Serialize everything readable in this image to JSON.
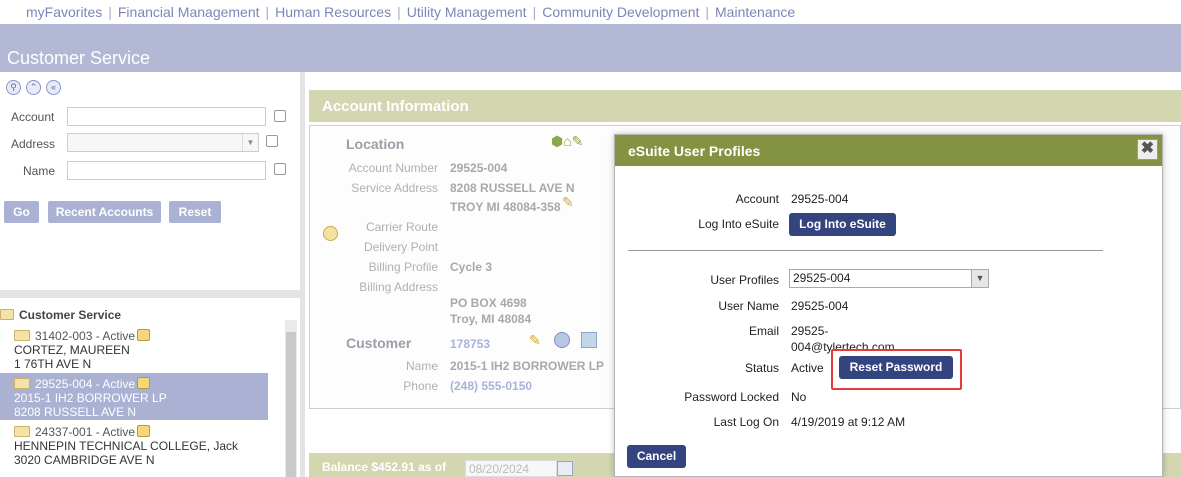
{
  "nav": {
    "items": [
      "myFavorites",
      "Financial Management",
      "Human Resources",
      "Utility Management",
      "Community Development",
      "Maintenance"
    ]
  },
  "header": {
    "title": "Customer Service"
  },
  "search": {
    "account_label": "Account",
    "address_label": "Address",
    "name_label": "Name",
    "go_label": "Go",
    "recent_label": "Recent Accounts",
    "reset_label": "Reset"
  },
  "tree": {
    "root": "Customer Service",
    "items": [
      {
        "id": "31402-003 - Active",
        "name": "CORTEZ, MAUREEN",
        "address": "1 76TH AVE N"
      },
      {
        "id": "29525-004 - Active",
        "name": "2015-1 IH2 BORROWER LP",
        "address": "8208 RUSSELL AVE N"
      },
      {
        "id": "24337-001 - Active",
        "name": "HENNEPIN TECHNICAL COLLEGE, Jack",
        "address": "3020 CAMBRIDGE AVE N"
      }
    ]
  },
  "account": {
    "title": "Account Information",
    "location_title": "Location",
    "account_number_label": "Account Number",
    "account_number": "29525-004",
    "service_address_label": "Service Address",
    "service_address_1": "8208 RUSSELL AVE N",
    "service_address_2": "TROY MI 48084-358",
    "carrier_route_label": "Carrier Route",
    "delivery_point_label": "Delivery Point",
    "billing_profile_label": "Billing Profile",
    "billing_profile": "Cycle 3",
    "billing_address_label": "Billing Address",
    "billing_address_1": "PO BOX 4698",
    "billing_address_2": "Troy, MI 48084",
    "customer_title": "Customer",
    "customer_id": "178753",
    "name_label": "Name",
    "name": "2015-1 IH2 BORROWER LP",
    "phone_label": "Phone",
    "phone": "(248) 555-0150"
  },
  "balance": {
    "text": "Balance  $452.91  as of",
    "date": "08/20/2024"
  },
  "dialog": {
    "title": "eSuite User Profiles",
    "close": "✖",
    "account_label": "Account",
    "account": "29525-004",
    "login_label": "Log Into eSuite",
    "login_button": "Log Into eSuite",
    "profiles_label": "User Profiles",
    "profile_selected": "29525-004",
    "username_label": "User Name",
    "username": "29525-004",
    "email_label": "Email",
    "email_line1": "29525-",
    "email_line2": "004@tylertech.com",
    "status_label": "Status",
    "status": "Active",
    "reset_password": "Reset Password",
    "locked_label": "Password Locked",
    "locked": "No",
    "lastlog_label": "Last Log On",
    "lastlog": "4/19/2019 at 9:12 AM",
    "cancel": "Cancel"
  }
}
